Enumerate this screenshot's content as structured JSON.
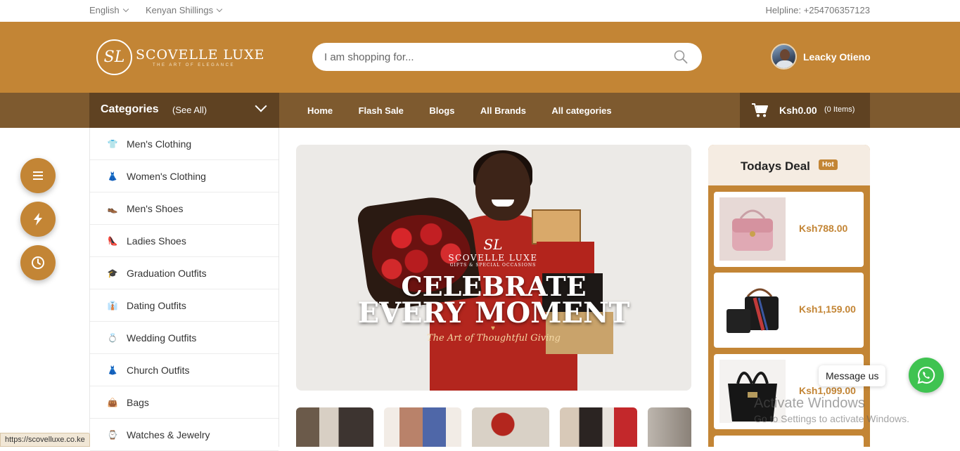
{
  "topbar": {
    "language": "English",
    "currency": "Kenyan Shillings",
    "helpline": "Helpline: +254706357123"
  },
  "header": {
    "logo_initials": "SL",
    "logo_name": "SCOVELLE LUXE",
    "logo_tagline": "THE ART OF ELEGANCE",
    "search_placeholder": "I am shopping for...",
    "user_name": "Leacky Otieno"
  },
  "nav": {
    "categories_title": "Categories",
    "categories_see_all": "(See All)",
    "menu": [
      "Home",
      "Flash Sale",
      "Blogs",
      "All Brands",
      "All categories"
    ],
    "cart_amount": "Ksh0.00",
    "cart_items": "(0 Items)"
  },
  "categories": [
    {
      "label": "Men's Clothing",
      "icon": "shirt-icon"
    },
    {
      "label": "Women's Clothing",
      "icon": "dress-icon"
    },
    {
      "label": "Men's Shoes",
      "icon": "shoe-icon"
    },
    {
      "label": "Ladies Shoes",
      "icon": "heel-icon"
    },
    {
      "label": "Graduation Outfits",
      "icon": "graduation-icon"
    },
    {
      "label": "Dating Outfits",
      "icon": "outfit-icon"
    },
    {
      "label": "Wedding Outfits",
      "icon": "ring-icon"
    },
    {
      "label": "Church Outfits",
      "icon": "dress-icon"
    },
    {
      "label": "Bags",
      "icon": "bag-icon"
    },
    {
      "label": "Watches & Jewelry",
      "icon": "watch-icon"
    }
  ],
  "banner": {
    "initials": "SL",
    "brand": "SCOVELLE LUXE",
    "brand_tag": "GIFTS & SPECIAL OCCASIONS",
    "headline_1": "CELEBRATE",
    "headline_2": "EVERY MOMENT",
    "tagline": "The Art of Thoughtful Giving"
  },
  "todays_deal": {
    "title": "Todays Deal",
    "badge": "Hot",
    "items": [
      {
        "price": "Ksh788.00"
      },
      {
        "price": "Ksh1,159.00"
      },
      {
        "price": "Ksh1,099.00"
      }
    ]
  },
  "chat": {
    "message_label": "Message us"
  },
  "watermark": {
    "line1": "Activate Windows",
    "line2": "Go to Settings to activate Windows."
  },
  "status_url": "https://scovelluxe.co.ke",
  "colors": {
    "brand": "#c38535",
    "nav_bg": "#7e5a2f",
    "nav_dark": "#5f4222",
    "whatsapp": "#3fc351"
  }
}
